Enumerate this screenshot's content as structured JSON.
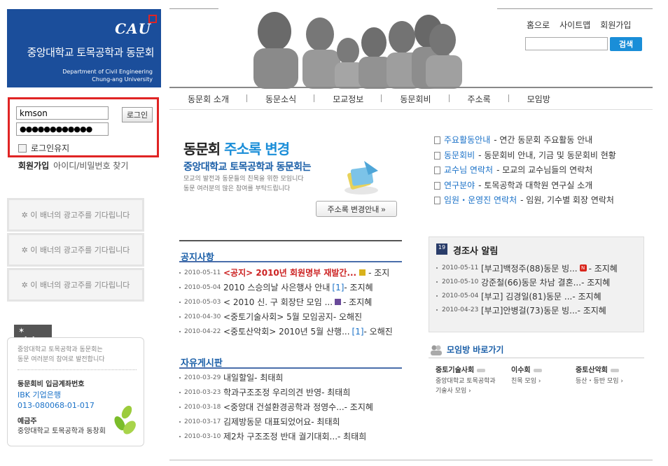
{
  "logo": {
    "cau": "CAU",
    "name": "중앙대학교 토목공학과 동문회",
    "eng_line1": "Department of Civil Engineering",
    "eng_line2": "Chung-ang University"
  },
  "login": {
    "id_value": "kmson",
    "pw_value": "●●●●●●●●●●●●",
    "button": "로그인",
    "keep": "로그인유지",
    "join": "회원가입",
    "find": "아이디/비밀번호 찾기"
  },
  "banners": [
    "✲ 이 배너의 광고주를 기다립니다",
    "✲ 이 배너의 광고주를 기다립니다",
    "✲ 이 배너의 광고주를 기다립니다"
  ],
  "giving": {
    "tag": "✶ giving",
    "desc1": "중앙대학교 토목공학과 동문회는",
    "desc2": "동문 여러분의 참여로 발전합니다",
    "acc_label": "동문회비 입금계좌번호",
    "bank": "IBK 기업은행",
    "account": "013-080068-01-017",
    "holder_label": "예금주",
    "holder": "중앙대학교 토목공학과 동창회"
  },
  "toplinks": {
    "home": "홈으로",
    "sitemap": "사이트맵",
    "join": "회원가입",
    "search_btn": "검색"
  },
  "nav": [
    "동문회 소개",
    "동문소식",
    "모교정보",
    "동문회비",
    "주소록",
    "모임방"
  ],
  "promo": {
    "title_a": "동문회 ",
    "title_b": "주소록 변경",
    "sub": "중앙대학교 토목공학과 동문회는",
    "desc1": "모교의 발전과 동문들의 친목을 위한 모임니다",
    "desc2": "동문 여러분의 많은 참여를 부탁드립니다",
    "button": "주소록 변경안내 »"
  },
  "quick": [
    {
      "k": "주요활동안내",
      "v": " - 연간 동문회 주요활동 안내"
    },
    {
      "k": "동문회비",
      "v": " - 동문회비 안내, 기금 및 동문회비 현황"
    },
    {
      "k": "교수님 연락처",
      "v": " - 모교의 교수님들의 연락처"
    },
    {
      "k": "연구분야",
      "v": " - 토목공학과 대학원 연구실 소개"
    },
    {
      "k": "임원・운영진 연락처",
      "v": " - 임원, 기수별 회장 연락처"
    }
  ],
  "notice": {
    "title": "공지사항",
    "rows": [
      {
        "date": "2010-05-11",
        "text": "<공지> 2010년 회원명부 재발간...",
        "red": true,
        "cnt": "",
        "author": " - 조지"
      },
      {
        "date": "2010-05-04",
        "text": "2010 스승의날 사은행사 안내",
        "red": false,
        "cnt": "[1]",
        "author": " - 조지혜"
      },
      {
        "date": "2010-05-03",
        "text": "< 2010 신. 구 회장단 모임 ...",
        "red": false,
        "cnt": "",
        "author": " - 조지혜"
      },
      {
        "date": "2010-04-30",
        "text": "<중토기술사회> 5월 모임공지",
        "red": false,
        "cnt": "",
        "author": " - 오해진"
      },
      {
        "date": "2010-04-22",
        "text": "<중토산악회> 2010년 5월 산행...",
        "red": false,
        "cnt": "[1]",
        "author": " - 오해진"
      }
    ]
  },
  "free": {
    "title": "자유게시판",
    "rows": [
      {
        "date": "2010-03-29",
        "text": "내일할일",
        "author": " - 최태희"
      },
      {
        "date": "2010-03-23",
        "text": "학과구조조정 우리의견 반영",
        "author": " - 최태희"
      },
      {
        "date": "2010-03-18",
        "text": "<중앙대 건설환경공학과 정영수...",
        "author": " - 조지혜"
      },
      {
        "date": "2010-03-17",
        "text": "김제방동문 대표되었어요",
        "author": " - 최태희"
      },
      {
        "date": "2010-03-10",
        "text": "제2차 구조조정 반대 궐기대회...",
        "author": " - 최태희"
      }
    ]
  },
  "obit": {
    "cal": "19",
    "title": "경조사 알림",
    "rows": [
      {
        "date": "2010-05-11",
        "text": "[부고]백정주(88)동문 빙...",
        "isnew": true,
        "new": "N",
        "author": " - 조지혜"
      },
      {
        "date": "2010-05-10",
        "text": "강준철(66)동문 차남 결혼...",
        "isnew": false,
        "new": "",
        "author": " - 조지혜"
      },
      {
        "date": "2010-05-04",
        "text": "[부고] 김경일(81)동문 ...",
        "isnew": false,
        "new": "",
        "author": " - 조지혜"
      },
      {
        "date": "2010-04-23",
        "text": "[부고]안병걸(73)동문 빙...",
        "isnew": false,
        "new": "",
        "author": " - 조지혜"
      }
    ]
  },
  "meeting": {
    "title": "모임방 바로가기",
    "groups": [
      {
        "h": "중토기술사회",
        "s1": "중앙대학교 토목공학과",
        "s2": "기술사 모임 ›"
      },
      {
        "h": "이수회",
        "s1": "친목 모임 ›",
        "s2": ""
      },
      {
        "h": "중토산악회",
        "s1": "등산・등반 모임 ›",
        "s2": ""
      }
    ]
  },
  "colors": {
    "brand": "#1b4e9b",
    "accent": "#1b8ed8",
    "alert": "#e02424"
  }
}
